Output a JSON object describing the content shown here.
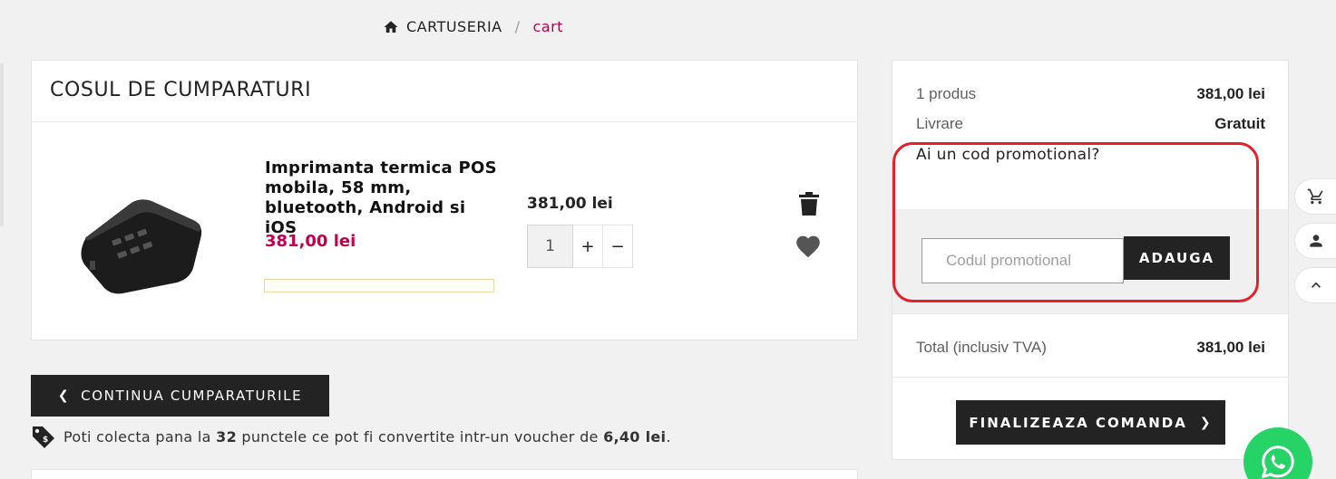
{
  "breadcrumb": {
    "home_icon": "home-icon",
    "root": "CARTUSERIA",
    "separator": "/",
    "current": "cart"
  },
  "cart": {
    "title": "COSUL DE CUMPARATURI",
    "item": {
      "image_icon": "thermal-printer-image",
      "name": "Imprimanta termica POS mobila, 58 mm, bluetooth, Android si iOS",
      "price": "381,00 lei",
      "unit_price": "381,00 lei",
      "quantity": "1",
      "increment_label": "+",
      "decrement_label": "−",
      "delete_icon": "trash-icon",
      "wishlist_icon": "heart-icon"
    },
    "continue_label": "CONTINUA CUMPARATURILE",
    "loyalty": {
      "tag_icon": "tag-icon",
      "text_before": "Poti colecta pana la",
      "points": "32",
      "text_middle": "punctele ce pot fi convertite intr-un voucher de",
      "voucher": "6,40 lei",
      "text_end": "."
    }
  },
  "summary": {
    "products_label": "1 produs",
    "products_value": "381,00 lei",
    "shipping_label": "Livrare",
    "shipping_value": "Gratuit",
    "promo_question": "Ai un cod promotional?",
    "promo_placeholder": "Codul promotional",
    "promo_button": "ADAUGA",
    "total_label": "Total (inclusiv TVA)",
    "total_value": "381,00 lei",
    "checkout_label": "FINALIZEAZA COMANDA"
  },
  "side_widgets": [
    "cart-icon",
    "user-icon",
    "chevron-up-icon"
  ],
  "colors": {
    "accent": "#c1004e",
    "dark_button": "#232323",
    "highlight_outline": "#e5202a",
    "whatsapp": "#25d366"
  }
}
